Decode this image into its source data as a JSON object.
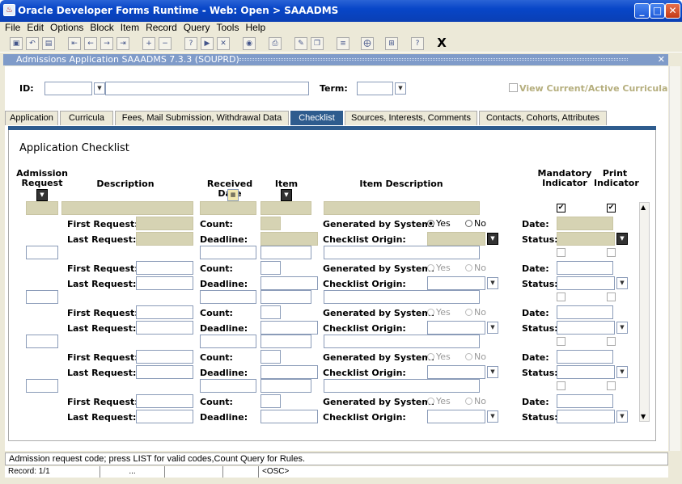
{
  "window": {
    "title": "Oracle Developer Forms Runtime - Web:  Open > SAAADMS",
    "app_icon": "java-cup-icon"
  },
  "menu": [
    "File",
    "Edit",
    "Options",
    "Block",
    "Item",
    "Record",
    "Query",
    "Tools",
    "Help"
  ],
  "toolbar": {
    "close_label": "X"
  },
  "form": {
    "title": "Admissions Application  SAAADMS  7.3.3  (SOUPRD)",
    "close_label": "✕"
  },
  "keyblock": {
    "id_label": "ID:",
    "term_label": "Term:",
    "curricula_label": "View Current/Active Curricula"
  },
  "tabs": [
    "Application",
    "Curricula",
    "Fees, Mail Submission, Withdrawal Data",
    "Checklist",
    "Sources, Interests, Comments",
    "Contacts, Cohorts, Attributes"
  ],
  "active_tab": "Checklist",
  "checklist": {
    "section_title": "Application Checklist",
    "headers": {
      "admission_request": "Admission Request",
      "description": "Description",
      "received_date": "Received Date",
      "item": "Item",
      "item_description": "Item Description",
      "mandatory": "Mandatory Indicator",
      "print": "Print Indicator"
    },
    "labels": {
      "first_request": "First Request:",
      "last_request": "Last Request:",
      "count": "Count:",
      "deadline": "Deadline:",
      "generated": "Generated by System:",
      "origin": "Checklist Origin:",
      "date": "Date:",
      "status": "Status:",
      "yes": "Yes",
      "no": "No"
    },
    "records": [
      {
        "active": true,
        "generated": "Yes",
        "mandatory": true,
        "print": true
      },
      {
        "active": false,
        "generated": "",
        "mandatory": false,
        "print": false
      },
      {
        "active": false,
        "generated": "",
        "mandatory": false,
        "print": false
      },
      {
        "active": false,
        "generated": "",
        "mandatory": false,
        "print": false
      },
      {
        "active": false,
        "generated": "",
        "mandatory": false,
        "print": false
      }
    ]
  },
  "status": {
    "message": "Admission request code; press LIST for valid codes,Count Query for Rules.",
    "record": "Record: 1/1",
    "seg3": "...",
    "osc": "<OSC>"
  }
}
